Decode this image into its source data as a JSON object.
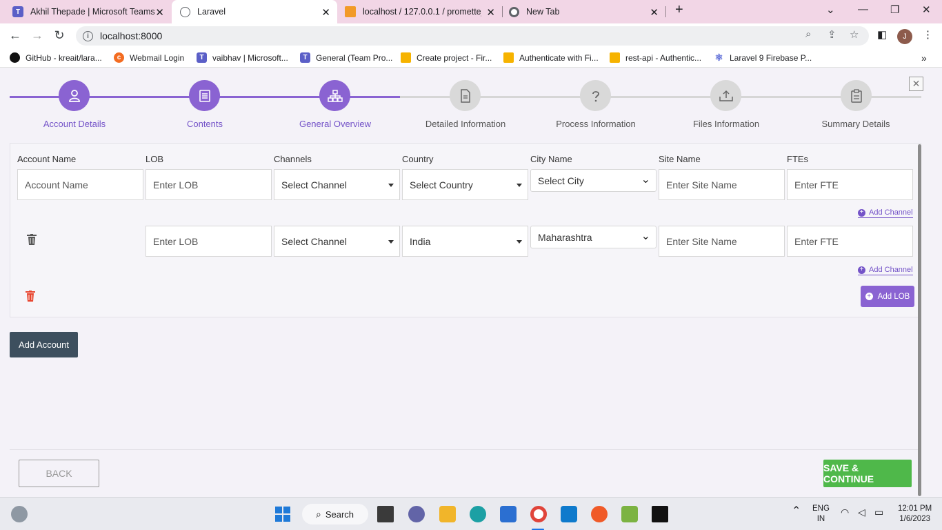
{
  "browser": {
    "tabs": [
      {
        "title": "Akhil Thepade | Microsoft Teams",
        "active": false
      },
      {
        "title": "Laravel",
        "active": true
      },
      {
        "title": "localhost / 127.0.0.1 / promette_",
        "active": false
      },
      {
        "title": "New Tab",
        "active": false
      }
    ],
    "url": "localhost:8000",
    "profile_initial": "J",
    "bookmarks": [
      "GitHub - kreait/lara...",
      "Webmail Login",
      "vaibhav | Microsoft...",
      "General (Team Pro...",
      "Create project - Fir...",
      "Authenticate with Fi...",
      "rest-api - Authentic...",
      "Laravel 9 Firebase P..."
    ]
  },
  "wizard": {
    "steps": [
      {
        "label": "Account Details",
        "done": true,
        "icon": "user-icon"
      },
      {
        "label": "Contents",
        "done": true,
        "icon": "list-icon"
      },
      {
        "label": "General Overview",
        "done": true,
        "icon": "sitemap-icon"
      },
      {
        "label": "Detailed Information",
        "done": false,
        "icon": "document-icon"
      },
      {
        "label": "Process Information",
        "done": false,
        "icon": "question-icon"
      },
      {
        "label": "Files Information",
        "done": false,
        "icon": "upload-icon"
      },
      {
        "label": "Summary Details",
        "done": false,
        "icon": "clipboard-icon"
      }
    ],
    "accent_color": "#8a63d2"
  },
  "form": {
    "columns": [
      "Account Name",
      "LOB",
      "Channels",
      "Country",
      "City Name",
      "Site Name",
      "FTEs"
    ],
    "row1": {
      "account_placeholder": "Account Name",
      "lob_placeholder": "Enter LOB",
      "channel": "Select Channel",
      "country": "Select Country",
      "city": "Select City",
      "site_placeholder": "Enter Site Name",
      "fte_placeholder": "Enter FTE"
    },
    "row2": {
      "lob_placeholder": "Enter LOB",
      "channel": "Select Channel",
      "country": "India",
      "city": "Maharashtra",
      "site_placeholder": "Enter Site Name",
      "fte_placeholder": "Enter FTE"
    },
    "add_channel_label": "Add Channel",
    "add_lob_label": "Add LOB",
    "add_account_label": "Add Account"
  },
  "footer": {
    "back_label": "BACK",
    "save_label": "SAVE & CONTINUE"
  },
  "taskbar": {
    "search_label": "Search",
    "language": "ENG",
    "region": "IN",
    "time": "12:01 PM",
    "date": "1/6/2023"
  }
}
